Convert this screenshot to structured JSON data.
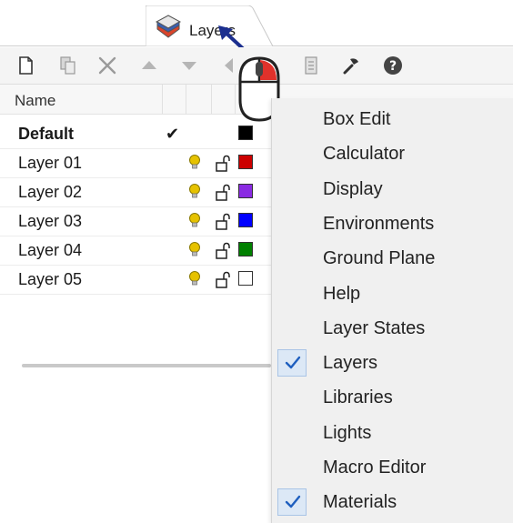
{
  "tab": {
    "label": "Layers"
  },
  "toolbar": {
    "buttons": [
      "new-layer-icon",
      "copy-layer-icon",
      "delete-icon",
      "move-up-icon",
      "move-down-icon",
      "previous-icon",
      "filter-icon",
      "properties-icon",
      "tools-icon",
      "help-icon"
    ]
  },
  "columns": {
    "name": "Name"
  },
  "layers": [
    {
      "name": "Default",
      "current": "✔",
      "color": "#000000",
      "bold": true
    },
    {
      "name": "Layer 01",
      "color": "#cc0000"
    },
    {
      "name": "Layer 02",
      "color": "#8a2be2"
    },
    {
      "name": "Layer 03",
      "color": "#0000ff"
    },
    {
      "name": "Layer 04",
      "color": "#008000"
    },
    {
      "name": "Layer 05",
      "color": "#ffffff"
    }
  ],
  "menu": {
    "items": [
      {
        "label": "Box Edit",
        "checked": false
      },
      {
        "label": "Calculator",
        "checked": false
      },
      {
        "label": "Display",
        "checked": false
      },
      {
        "label": "Environments",
        "checked": false
      },
      {
        "label": "Ground Plane",
        "checked": false
      },
      {
        "label": "Help",
        "checked": false
      },
      {
        "label": "Layer States",
        "checked": false
      },
      {
        "label": "Layers",
        "checked": true
      },
      {
        "label": "Libraries",
        "checked": false
      },
      {
        "label": "Lights",
        "checked": false
      },
      {
        "label": "Macro Editor",
        "checked": false
      },
      {
        "label": "Materials",
        "checked": true
      }
    ]
  },
  "colors": {
    "accent": "#1f5fbf",
    "menu_bg": "#f0f0f0",
    "bulb": "#e6c200"
  }
}
